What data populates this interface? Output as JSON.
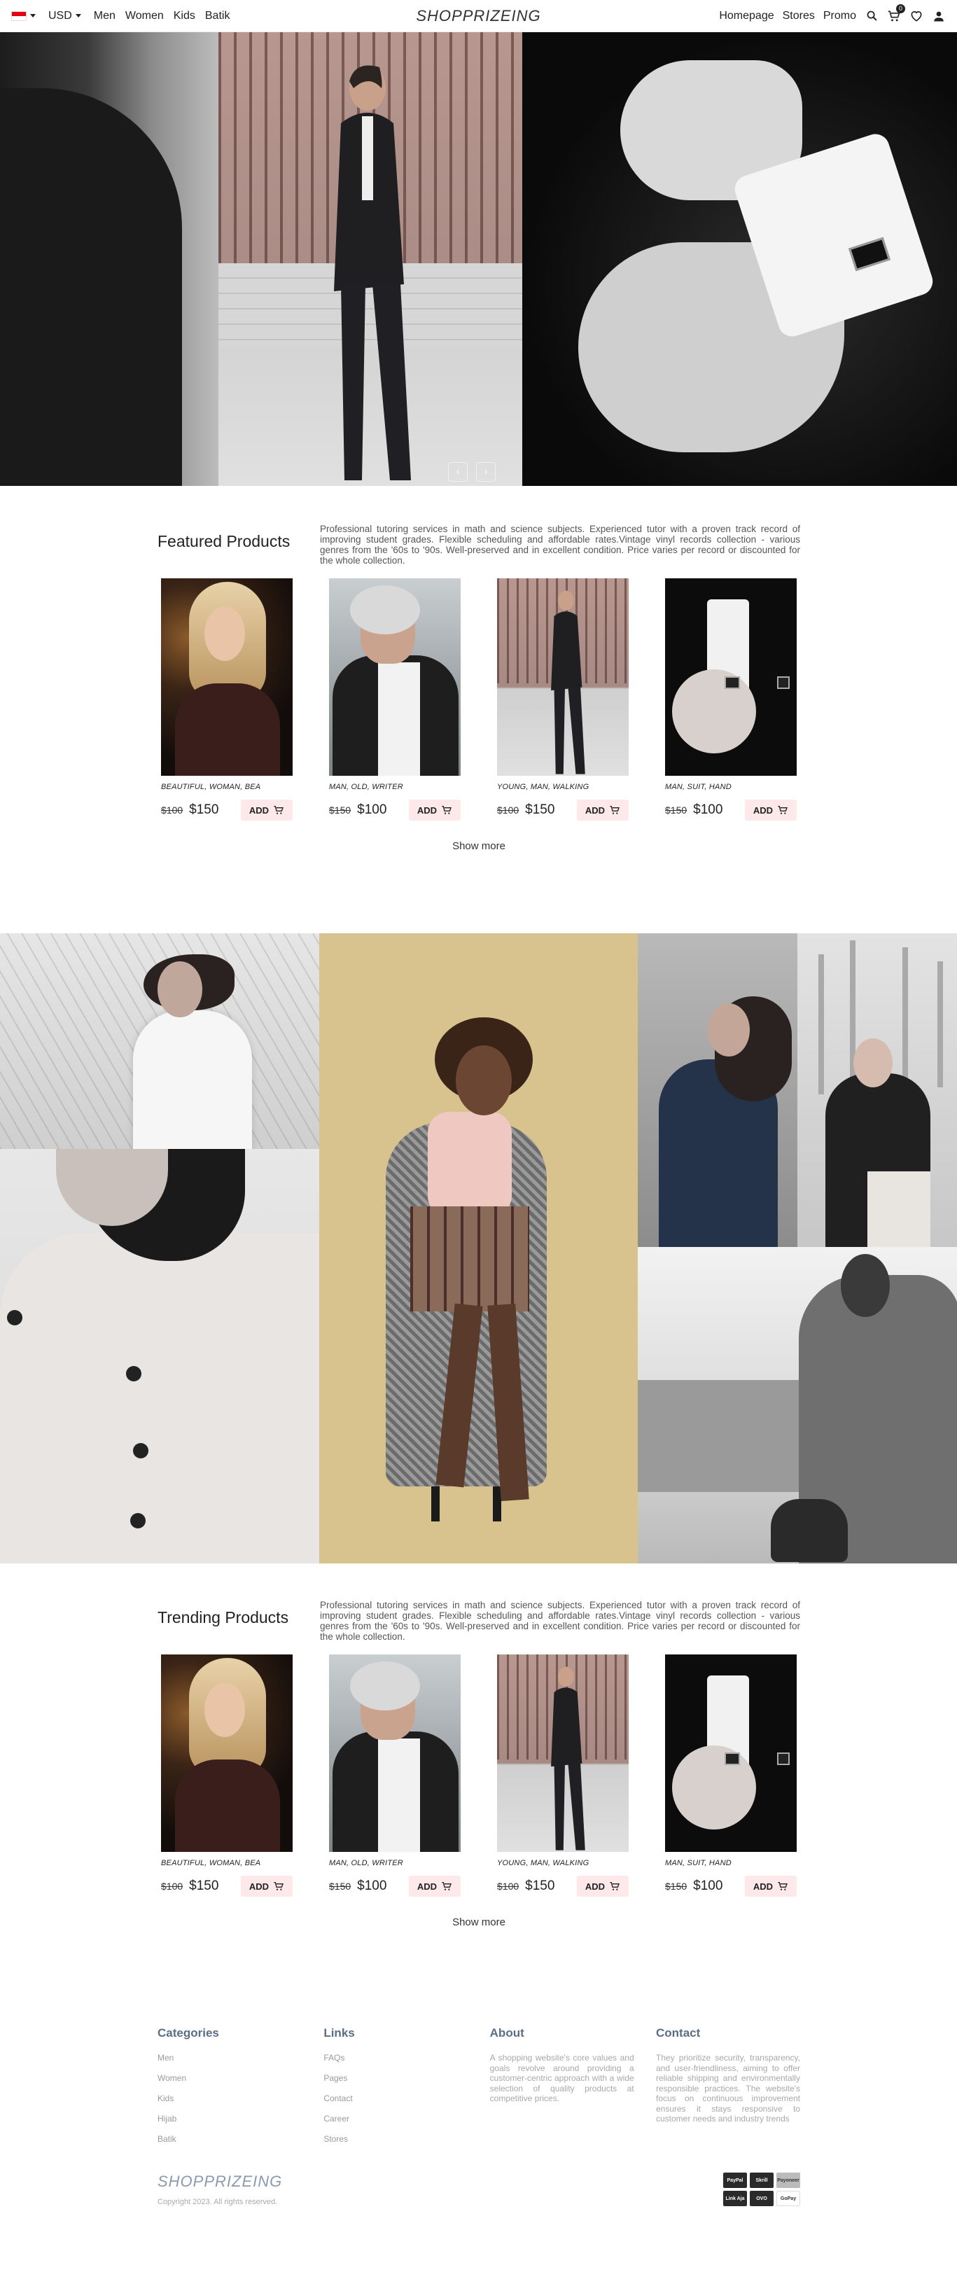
{
  "nav": {
    "currency": "USD",
    "links_left": [
      "Men",
      "Women",
      "Kids",
      "Batik"
    ],
    "brand": "SHOPPRIZEING",
    "links_right": [
      "Homepage",
      "Stores",
      "Promo"
    ],
    "cart_count": "0"
  },
  "hero": {
    "prev": "‹",
    "next": "›"
  },
  "featured": {
    "title": "Featured Products",
    "description": "Professional tutoring services in math and science subjects. Experienced tutor with a proven track record of improving student grades. Flexible scheduling and affordable rates.Vintage vinyl records collection - various genres from the '60s to '90s. Well-preserved and in excellent condition. Price varies per record or discounted for the whole collection.",
    "products": [
      {
        "category": "BEAUTIFUL, WOMAN, BEA",
        "old_price": "$100",
        "price": "$150",
        "add": "ADD"
      },
      {
        "category": "MAN, OLD, WRITER",
        "old_price": "$150",
        "price": "$100",
        "add": "ADD"
      },
      {
        "category": "YOUNG, MAN, WALKING",
        "old_price": "$100",
        "price": "$150",
        "add": "ADD"
      },
      {
        "category": "MAN, SUIT, HAND",
        "old_price": "$150",
        "price": "$100",
        "add": "ADD"
      }
    ],
    "show_more": "Show more"
  },
  "trending": {
    "title": "Trending Products",
    "description": "Professional tutoring services in math and science subjects. Experienced tutor with a proven track record of improving student grades. Flexible scheduling and affordable rates.Vintage vinyl records collection - various genres from the '60s to '90s. Well-preserved and in excellent condition. Price varies per record or discounted for the whole collection.",
    "products": [
      {
        "category": "BEAUTIFUL, WOMAN, BEA",
        "old_price": "$100",
        "price": "$150",
        "add": "ADD"
      },
      {
        "category": "MAN, OLD, WRITER",
        "old_price": "$150",
        "price": "$100",
        "add": "ADD"
      },
      {
        "category": "YOUNG, MAN, WALKING",
        "old_price": "$100",
        "price": "$150",
        "add": "ADD"
      },
      {
        "category": "MAN, SUIT, HAND",
        "old_price": "$150",
        "price": "$100",
        "add": "ADD"
      }
    ],
    "show_more": "Show more"
  },
  "footer": {
    "categories": {
      "title": "Categories",
      "items": [
        "Men",
        "Women",
        "Kids",
        "Hijab",
        "Batik"
      ]
    },
    "links": {
      "title": "Links",
      "items": [
        "FAQs",
        "Pages",
        "Contact",
        "Career",
        "Stores"
      ]
    },
    "about": {
      "title": "About",
      "text": "A shopping website's core values and goals revolve around providing a customer-centric approach with a wide selection of quality products at competitive prices."
    },
    "contact": {
      "title": "Contact",
      "text": "They prioritize security, transparency, and user-friendliness, aiming to offer reliable shipping and environmentally responsible practices. The website's focus on continuous improvement ensures it stays responsive to customer needs and industry trends"
    },
    "brand": "SHOPPRIZEING",
    "copyright": "Copyright 2023. All rights reserved.",
    "payments": [
      "PayPal",
      "Skrill",
      "Payoneer",
      "Link Aja",
      "OVO",
      "GoPay"
    ]
  }
}
